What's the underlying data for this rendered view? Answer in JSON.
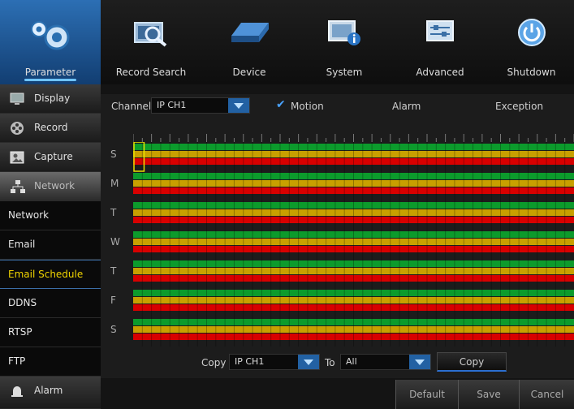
{
  "topbar": {
    "items": [
      {
        "label": "Parameter",
        "icon": "gears-icon",
        "active": true
      },
      {
        "label": "Record Search",
        "icon": "record-search-icon"
      },
      {
        "label": "Device",
        "icon": "hard-drive-icon"
      },
      {
        "label": "System",
        "icon": "system-info-icon"
      },
      {
        "label": "Advanced",
        "icon": "advanced-settings-icon"
      },
      {
        "label": "Shutdown",
        "icon": "power-icon"
      }
    ]
  },
  "sidebar": {
    "items": [
      {
        "label": "Display",
        "icon": "monitor-icon"
      },
      {
        "label": "Record",
        "icon": "film-reel-icon"
      },
      {
        "label": "Capture",
        "icon": "camera-capture-icon"
      },
      {
        "label": "Network",
        "icon": "network-icon"
      },
      {
        "label": "Network"
      },
      {
        "label": "Email"
      },
      {
        "label": "Email Schedule"
      },
      {
        "label": "DDNS"
      },
      {
        "label": "RTSP"
      },
      {
        "label": "FTP"
      },
      {
        "label": "Alarm",
        "icon": "alarm-bell-icon"
      }
    ]
  },
  "schedule": {
    "channel_label": "Channel",
    "channel_value": "IP CH1",
    "motion_label": "Motion",
    "alarm_label": "Alarm",
    "exception_label": "Exception",
    "days": [
      "S",
      "M",
      "T",
      "W",
      "T",
      "F",
      "S"
    ],
    "colors": {
      "motion": "#0c9b2c",
      "alarm": "#c8a000",
      "exception": "#d80000",
      "highlight": "#e8e000"
    },
    "copy_label": "Copy",
    "copy_from_value": "IP CH1",
    "to_label": "To",
    "to_value": "All",
    "copy_button": "Copy"
  },
  "footer": {
    "default_label": "Default",
    "save_label": "Save",
    "cancel_label": "Cancel"
  }
}
